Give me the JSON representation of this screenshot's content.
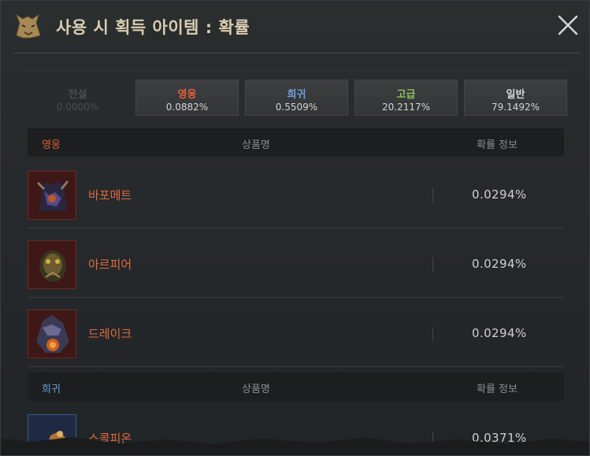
{
  "header": {
    "title": "사용 시 획득 아이템 : 확률",
    "icon": "wolf-head-icon",
    "close_icon": "close-icon"
  },
  "colors": {
    "legendary": "#555a5d",
    "heroic": "#e0603a",
    "rare": "#6f9fe0",
    "advanced": "#8fc060",
    "normal": "#d8d8d8"
  },
  "tabs": [
    {
      "name": "전설",
      "pct": "0.0000%",
      "enabled": false
    },
    {
      "name": "영웅",
      "pct": "0.0882%",
      "enabled": true
    },
    {
      "name": "희귀",
      "pct": "0.5509%",
      "enabled": true
    },
    {
      "name": "고급",
      "pct": "20.2117%",
      "enabled": true
    },
    {
      "name": "일반",
      "pct": "79.1492%",
      "enabled": true
    }
  ],
  "sections": [
    {
      "grade": "영웅",
      "col_name": "상품명",
      "col_prob": "확률 정보",
      "items": [
        {
          "name": "바포메트",
          "prob": "0.0294%",
          "icon": "baphomet-icon"
        },
        {
          "name": "아르피어",
          "prob": "0.0294%",
          "icon": "arpier-icon"
        },
        {
          "name": "드레이크",
          "prob": "0.0294%",
          "icon": "drake-icon"
        }
      ]
    },
    {
      "grade": "희귀",
      "col_name": "상품명",
      "col_prob": "확률 정보",
      "items": [
        {
          "name": "스콜피온",
          "prob": "0.0371%",
          "icon": "scorpion-icon"
        }
      ]
    }
  ]
}
